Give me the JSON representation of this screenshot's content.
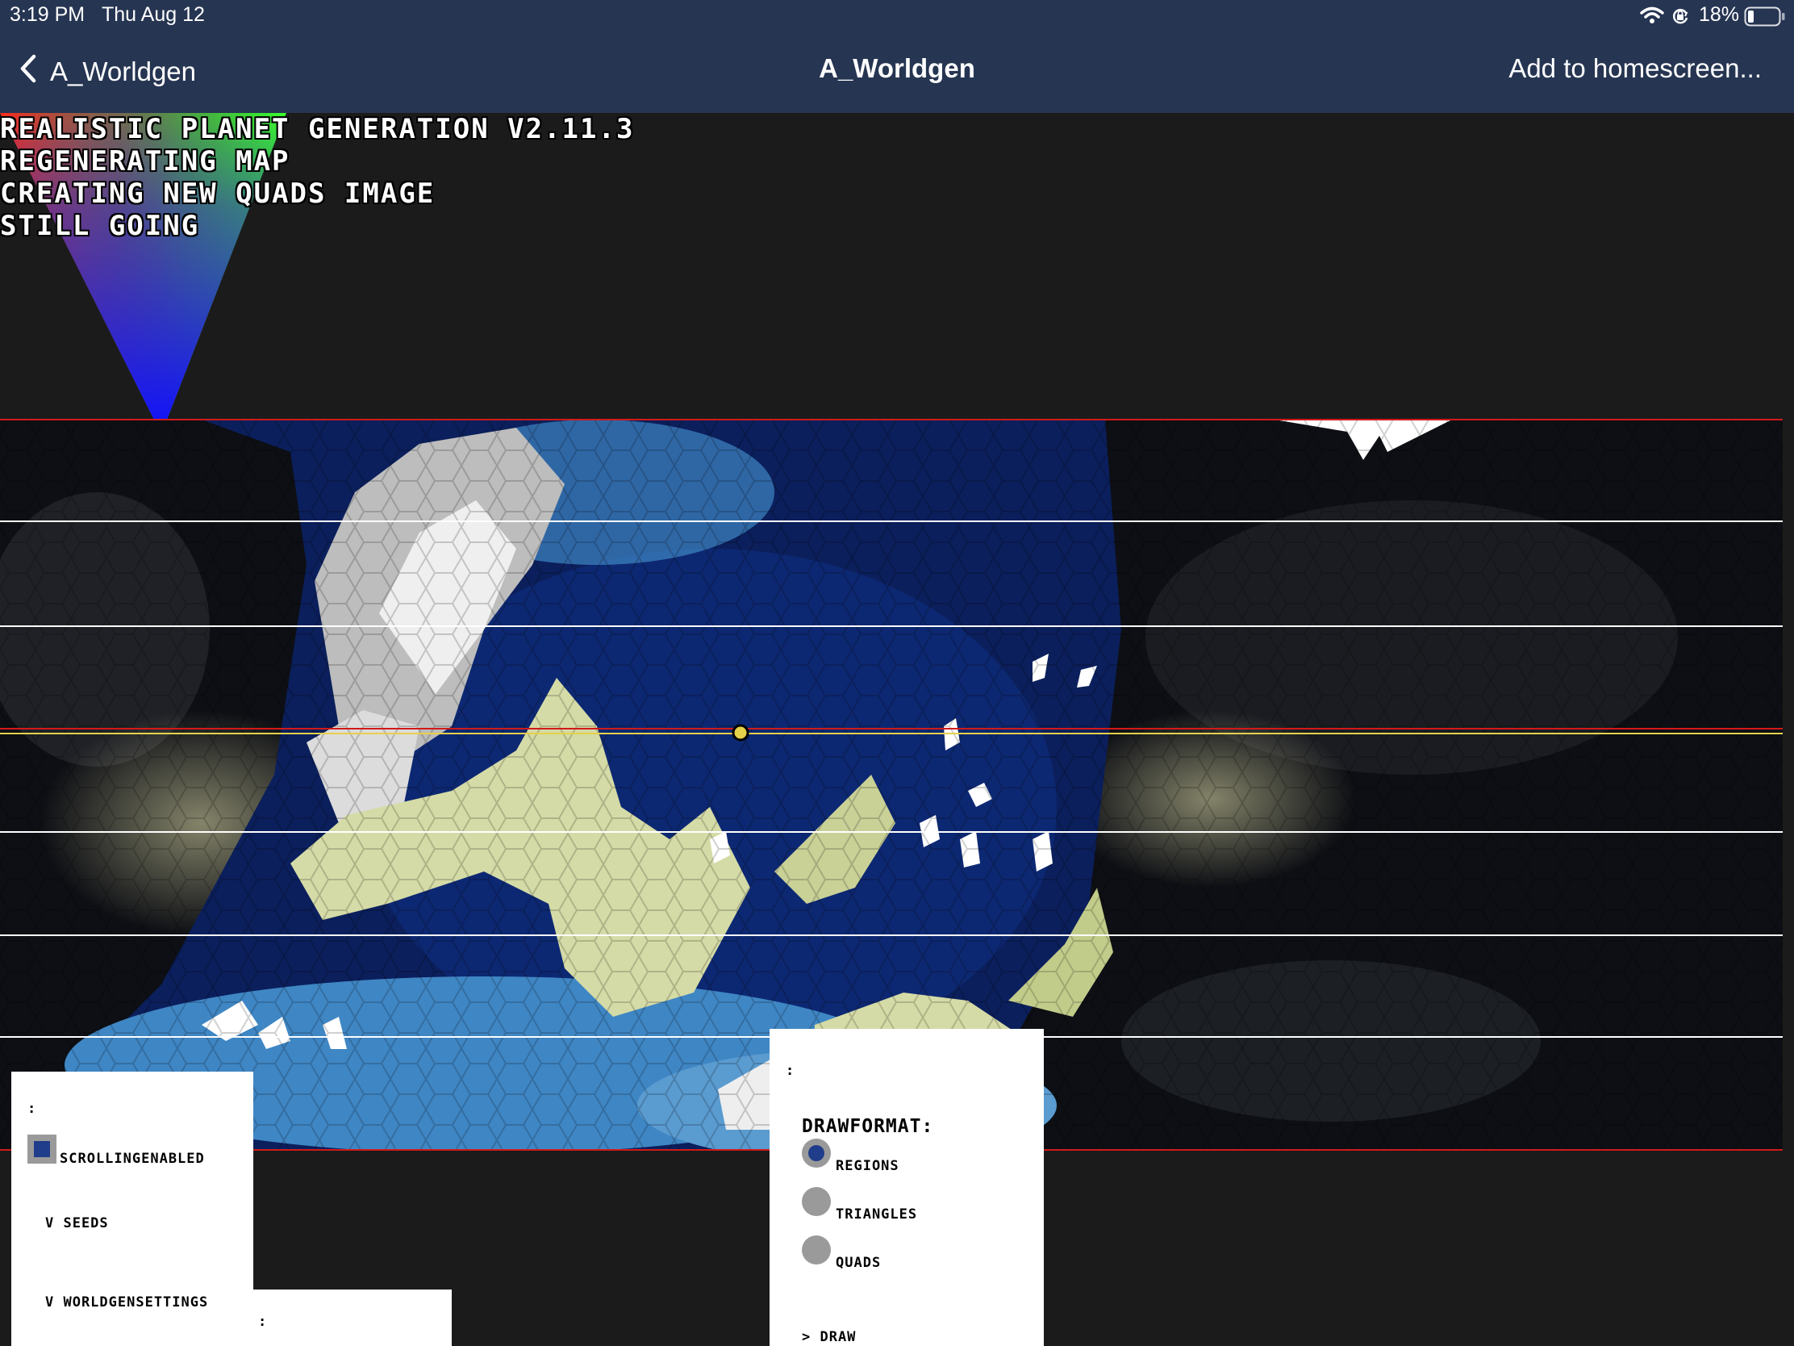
{
  "status_bar": {
    "time": "3:19 PM",
    "date": "Thu Aug 12",
    "battery": "18%",
    "icons": [
      "wifi-icon",
      "orientation-lock-icon",
      "battery-icon"
    ]
  },
  "nav_bar": {
    "back_label": "A_Worldgen",
    "title": "A_Worldgen",
    "action_label": "Add to homescreen..."
  },
  "overlay": {
    "lines": [
      "Realistic Planet Generation v2.11.3",
      "Regenerating map",
      "creating new quads image",
      "still going"
    ]
  },
  "left_panel": {
    "header": ":",
    "checkbox_label": "scrollingEnabled",
    "checkbox_checked": true,
    "folders": [
      "v seeds",
      "v worldgenSettings"
    ],
    "sub_header": ":"
  },
  "draw_panel": {
    "header": ":",
    "format_label": "drawFormat:",
    "options": [
      {
        "label": "Regions",
        "selected": true
      },
      {
        "label": "Triangles",
        "selected": false
      },
      {
        "label": "Quads",
        "selected": false
      }
    ],
    "footer": "> draw"
  },
  "colors": {
    "bars": "#263552",
    "ocean_deep": "#0b1f5c",
    "ocean_shallow": "#3f86c4",
    "land": "#d5dba6",
    "ice": "#ffffff",
    "accent_red": "#d11a1a",
    "accent_yellow": "#e6d14a"
  }
}
